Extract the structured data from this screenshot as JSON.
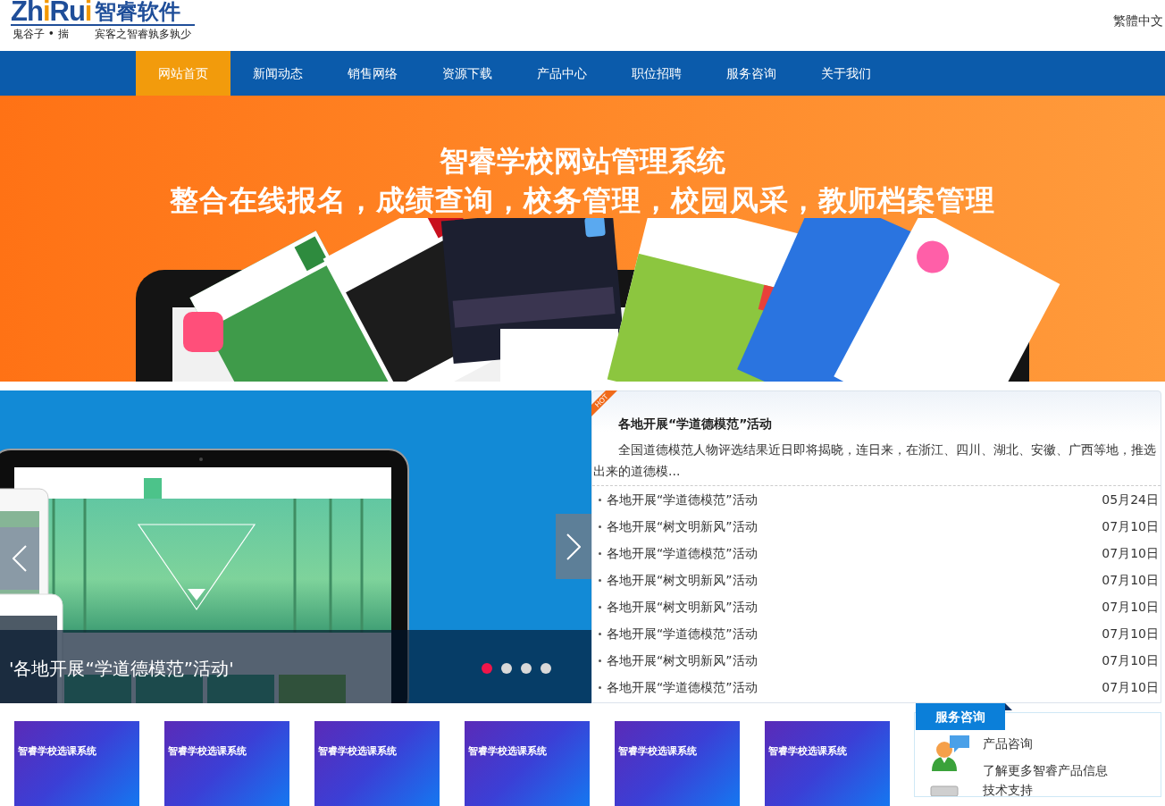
{
  "header": {
    "logo": {
      "wordmark": [
        {
          "text": "Zh",
          "accent": false
        },
        {
          "text": "i",
          "accent": true
        },
        {
          "text": "Ru",
          "accent": false
        },
        {
          "text": "i",
          "accent": true
        }
      ],
      "name_cn": "智睿软件",
      "tagline_left": "鬼谷子 • 揣",
      "tagline_right": "宾客之智睿孰多孰少"
    },
    "language_link": "繁體中文"
  },
  "nav": [
    {
      "label": "网站首页",
      "selected": true
    },
    {
      "label": "新闻动态",
      "selected": false
    },
    {
      "label": "销售网络",
      "selected": false
    },
    {
      "label": "资源下载",
      "selected": false
    },
    {
      "label": "产品中心",
      "selected": false
    },
    {
      "label": "职位招聘",
      "selected": false
    },
    {
      "label": "服务咨询",
      "selected": false
    },
    {
      "label": "关于我们",
      "selected": false
    }
  ],
  "banner": {
    "title": "智睿学校网站管理系统",
    "subtitle": "整合在线报名，成绩查询，校务管理，校园风采，教师档案管理"
  },
  "slider": {
    "caption": "'各地开展“学道德模范”活动'",
    "dots": [
      {
        "selected": true
      },
      {
        "selected": false
      },
      {
        "selected": false
      },
      {
        "selected": false
      }
    ]
  },
  "news": {
    "badge": "HOT",
    "featured": {
      "title": "各地开展“学道德模范”活动",
      "summary": "全国道德模范人物评选结果近日即将揭晓，连日来，在浙江、四川、湖北、安徽、广西等地，推选出来的道德模..."
    },
    "items": [
      {
        "title": "各地开展“学道德模范”活动",
        "date": "05月24日"
      },
      {
        "title": "各地开展“树文明新风”活动",
        "date": "07月10日"
      },
      {
        "title": "各地开展“学道德模范”活动",
        "date": "07月10日"
      },
      {
        "title": "各地开展“树文明新风”活动",
        "date": "07月10日"
      },
      {
        "title": "各地开展“树文明新风”活动",
        "date": "07月10日"
      },
      {
        "title": "各地开展“学道德模范”活动",
        "date": "07月10日"
      },
      {
        "title": "各地开展“树文明新风”活动",
        "date": "07月10日"
      },
      {
        "title": "各地开展“学道德模范”活动",
        "date": "07月10日"
      }
    ]
  },
  "products": [
    {
      "title": "智睿学校选课系统"
    },
    {
      "title": "智睿学校选课系统"
    },
    {
      "title": "智睿学校选课系统"
    },
    {
      "title": "智睿学校选课系统"
    },
    {
      "title": "智睿学校选课系统"
    },
    {
      "title": "智睿学校选课系统"
    }
  ],
  "service": {
    "title": "服务咨询",
    "items": [
      {
        "kind": "consult",
        "title": "产品咨询",
        "description": "了解更多智睿产品信息"
      },
      {
        "kind": "support",
        "title": "技术支持"
      }
    ]
  }
}
